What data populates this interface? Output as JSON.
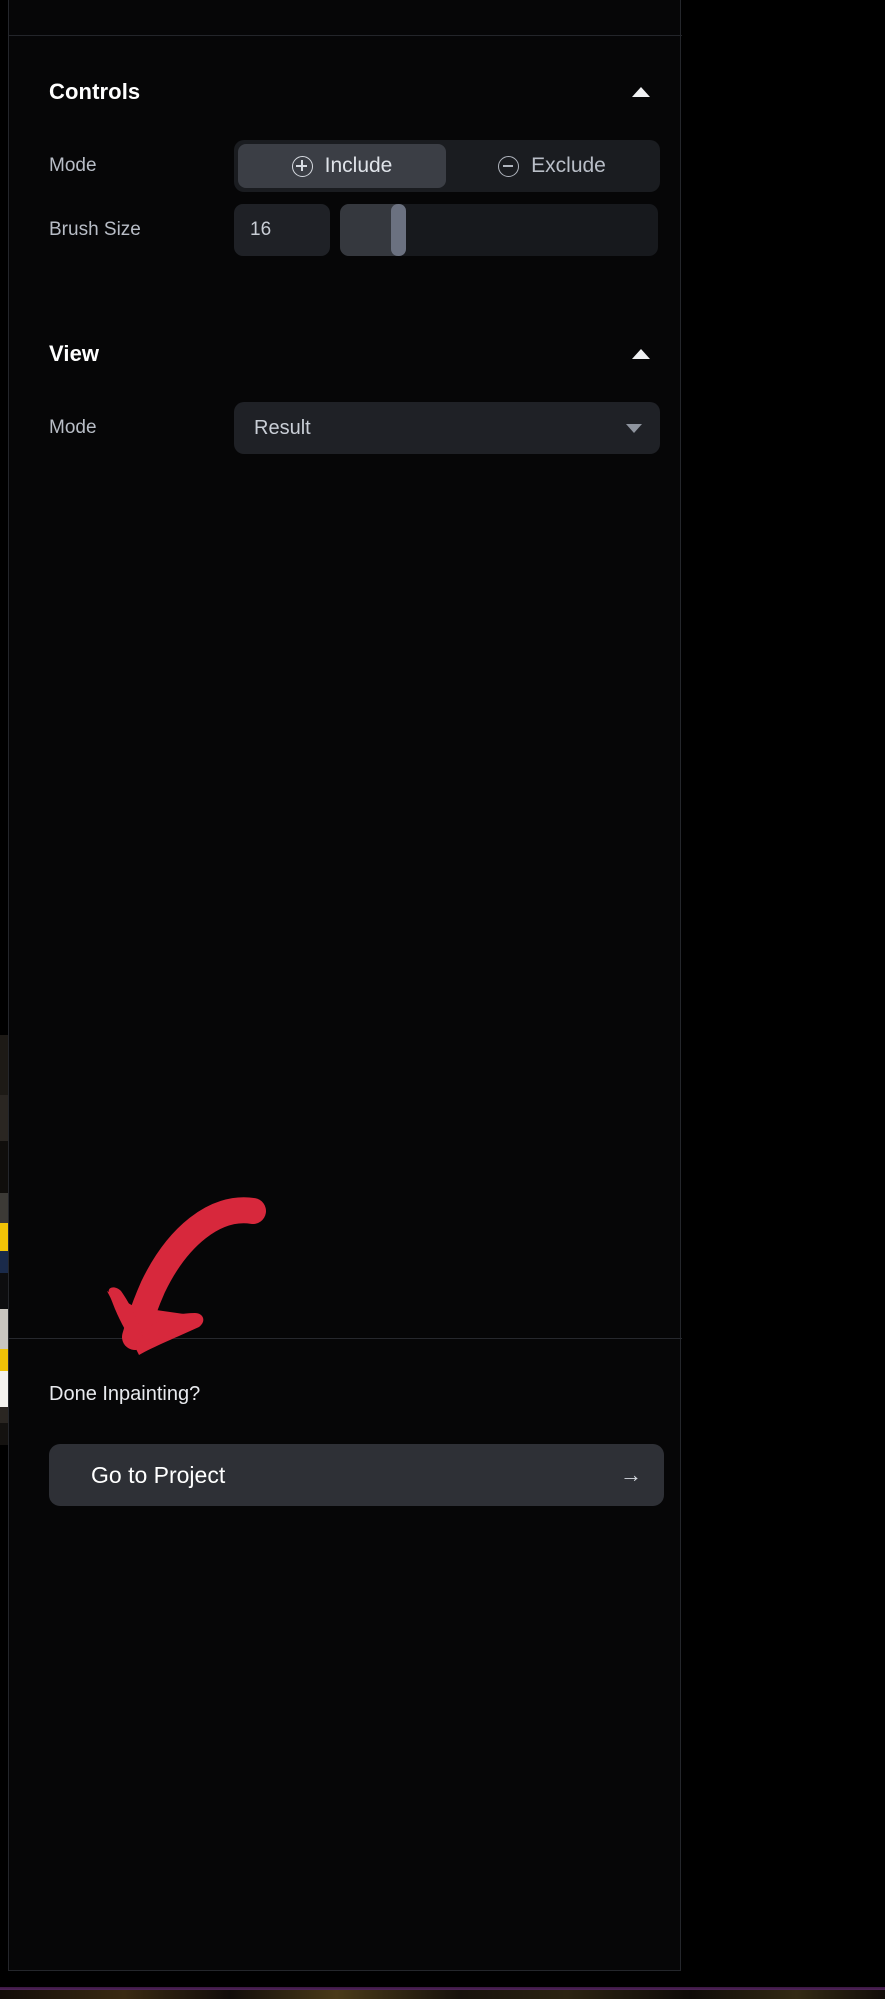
{
  "panel": {
    "sections": [
      {
        "id": "controls",
        "title": "Controls",
        "collapse_icon": "chevron-up-icon",
        "rows": [
          {
            "id": "mode",
            "label": "Mode",
            "type": "segmented",
            "options": [
              {
                "label": "Include",
                "icon": "plus-circle-icon",
                "selected": true
              },
              {
                "label": "Exclude",
                "icon": "minus-circle-icon",
                "selected": false
              }
            ]
          },
          {
            "id": "brush-size",
            "label": "Brush Size",
            "type": "number-slider",
            "value": "16",
            "slider_percent": 18
          }
        ]
      },
      {
        "id": "view",
        "title": "View",
        "collapse_icon": "chevron-up-icon",
        "rows": [
          {
            "id": "view-mode",
            "label": "Mode",
            "type": "select",
            "value": "Result",
            "caret_icon": "caret-down-icon"
          }
        ]
      }
    ]
  },
  "footer": {
    "prompt": "Done Inpainting?",
    "cta_label": "Go to Project",
    "cta_arrow": "→",
    "cta_arrow_icon": "arrow-right-icon"
  },
  "annotation": {
    "type": "curved-arrow",
    "color": "#d7283c",
    "points_to": "done-inpainting-prompt"
  },
  "colors": {
    "panel_bg": "#060607",
    "panel_border": "#24262b",
    "field_bg": "#1f2126",
    "segment_active_bg": "#3b3e45",
    "cta_bg": "#2e3036",
    "text_primary": "#ffffff",
    "text_secondary": "#b8bdc6",
    "annotation_red": "#d7283c",
    "bottom_strip": "#5a2a66"
  }
}
